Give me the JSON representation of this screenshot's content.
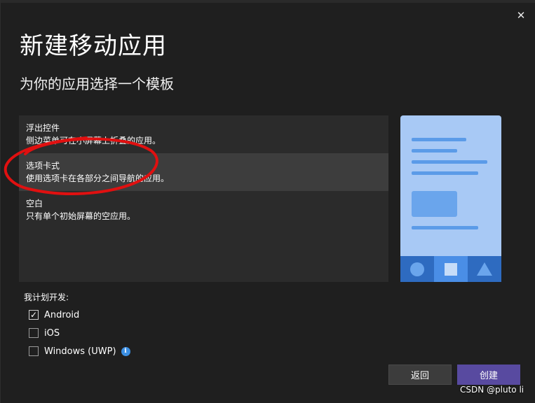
{
  "dialog": {
    "title": "新建移动应用",
    "subtitle": "为你的应用选择一个模板",
    "close_glyph": "✕"
  },
  "templates": [
    {
      "name": "浮出控件",
      "description": "侧边菜单可在小屏幕上折叠的应用。",
      "selected": false
    },
    {
      "name": "选项卡式",
      "description": "使用选项卡在各部分之间导航的应用。",
      "selected": true
    },
    {
      "name": "空白",
      "description": "只有单个初始屏幕的空应用。",
      "selected": false
    }
  ],
  "preview": {
    "icons": [
      "circle-icon",
      "square-icon",
      "triangle-icon"
    ],
    "active_tab": 1,
    "colors": {
      "background": "#a8c9f5",
      "accent": "#5b9be8",
      "tabbar": "#2e6bc0",
      "active_tab": "#4a8ee6"
    }
  },
  "platforms": {
    "label": "我计划开发:",
    "items": [
      {
        "label": "Android",
        "checked": true,
        "check_glyph": "✓"
      },
      {
        "label": "iOS",
        "checked": false,
        "check_glyph": ""
      },
      {
        "label": "Windows (UWP)",
        "checked": false,
        "check_glyph": "",
        "info_glyph": "i"
      }
    ]
  },
  "buttons": {
    "back_label": "返回",
    "create_label": "创建"
  },
  "watermark": "CSDN @pluto li",
  "colors": {
    "background": "#1f1f1f",
    "list_background": "#2b2b2b",
    "selected_item": "#3d3d3d",
    "primary_button": "#584aa0",
    "annotation_stroke": "#e01010"
  }
}
